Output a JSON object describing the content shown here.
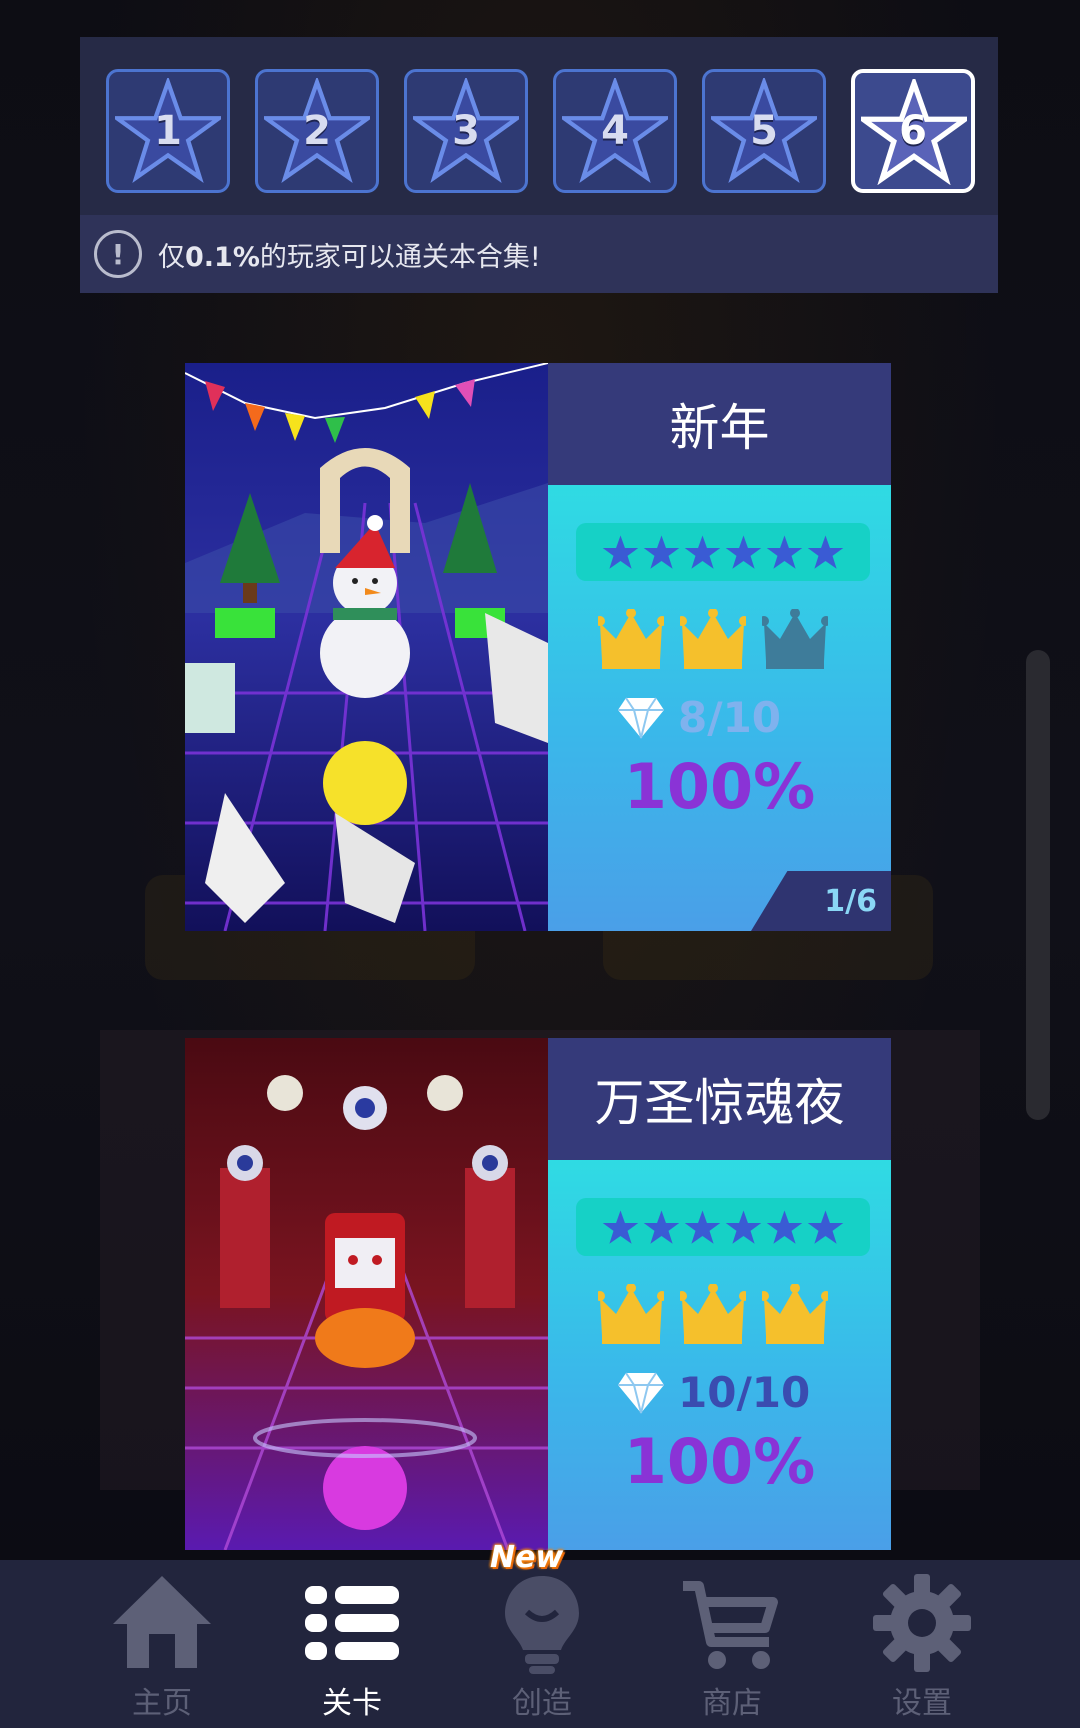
{
  "level_selector": {
    "tabs": [
      {
        "label": "1",
        "active": false
      },
      {
        "label": "2",
        "active": false
      },
      {
        "label": "3",
        "active": false
      },
      {
        "label": "4",
        "active": false
      },
      {
        "label": "5",
        "active": false
      },
      {
        "label": "6",
        "active": true
      }
    ],
    "notice": {
      "icon": "exclamation-icon",
      "prefix": "仅",
      "highlight": "0.1%",
      "suffix": "的玩家可以通关本合集!"
    }
  },
  "cards": [
    {
      "title": "新年",
      "stars": 6,
      "crowns_earned": 2,
      "crowns_total": 3,
      "gems": "8/10",
      "percent": "100%",
      "page": "1/6",
      "art": "new-year-snowman-art"
    },
    {
      "title": "万圣惊魂夜",
      "stars": 6,
      "crowns_earned": 3,
      "crowns_total": 3,
      "gems": "10/10",
      "percent": "100%",
      "art": "halloween-vampire-art"
    }
  ],
  "bottom_nav": {
    "items": [
      {
        "label": "主页",
        "icon": "home-icon",
        "active": false
      },
      {
        "label": "关卡",
        "icon": "list-icon",
        "active": true
      },
      {
        "label": "创造",
        "icon": "lightbulb-icon",
        "active": false
      },
      {
        "label": "商店",
        "icon": "cart-icon",
        "active": false
      },
      {
        "label": "设置",
        "icon": "gear-icon",
        "active": false
      }
    ],
    "new_badge": "New"
  },
  "colors": {
    "panel": "#262a46",
    "tab_border": "#4c74d0",
    "title_bg": "#353a7a",
    "crown_gold": "#f5c02c",
    "crown_dim": "#3e7c9a",
    "percent": "#8a33d6",
    "nav_bg": "#22253d"
  }
}
